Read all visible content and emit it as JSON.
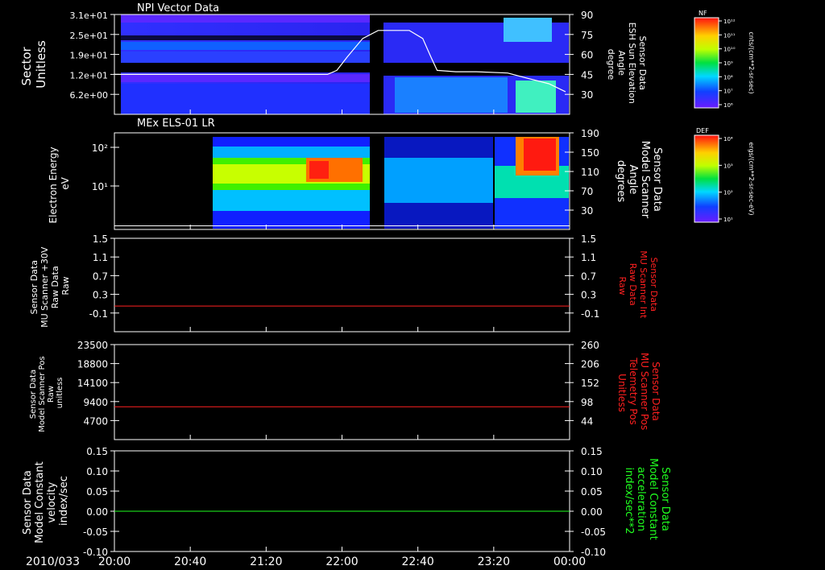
{
  "chart_data": [
    {
      "type": "heatmap",
      "panel": "npi",
      "title": "NPI Vector Data",
      "ylabel": [
        "Sector",
        "Unitless"
      ],
      "yticks": [
        "3.1e+01",
        "2.5e+01",
        "1.9e+01",
        "1.2e+01",
        "6.2e+00"
      ],
      "y2label": [
        "Sensor Data",
        "ESH Sun Elevation",
        "Angle",
        "degree"
      ],
      "y2ticks": [
        "90",
        "75",
        "60",
        "45",
        "30"
      ],
      "y2lim": [
        15,
        90
      ],
      "colorbar": {
        "label": "NF",
        "units": "cnts/(cm**2-sr-sec)",
        "ticks": [
          "10¹²",
          "10¹¹",
          "10¹⁰",
          "10⁹",
          "10⁸",
          "10⁷",
          "10⁶"
        ]
      },
      "line_series": {
        "color": "#ffffff",
        "x_minutes": [
          0,
          206,
          215,
          225,
          240,
          255,
          268,
          285,
          298,
          306,
          312,
          330,
          350,
          380,
          400,
          420,
          436
        ],
        "y": [
          45,
          45,
          48,
          58,
          72,
          78,
          78,
          78,
          72,
          58,
          48,
          47,
          47,
          46,
          42,
          38,
          32
        ]
      }
    },
    {
      "type": "heatmap",
      "panel": "els",
      "title": "MEx ELS-01 LR",
      "ylabel": [
        "Electron Energy",
        "eV"
      ],
      "yticks": [
        "10²",
        "10¹"
      ],
      "y2label": [
        "Sensor Data",
        "Model Scanner",
        "Angle",
        "degrees"
      ],
      "y2ticks": [
        "190",
        "150",
        "110",
        "70",
        "30"
      ],
      "y2lim": [
        5,
        190
      ],
      "colorbar": {
        "label": "DEF",
        "units": "ergs/(cm**2-sr-sec-eV)",
        "ticks": [
          "10⁴",
          "10³",
          "10²",
          "10¹"
        ]
      },
      "line_series": {
        "color": "#ffffff",
        "x_minutes": [
          0,
          440
        ],
        "y": [
          12,
          12
        ]
      }
    },
    {
      "type": "line",
      "panel": "mu-int",
      "ylabel": [
        "Sensor Data",
        "MU Scanner +30V",
        "Raw Data",
        "Raw"
      ],
      "yticks": [
        "1.5",
        "1.1",
        "0.7",
        "0.3",
        "-0.1"
      ],
      "ylim": [
        -0.5,
        1.5
      ],
      "y2label": [
        "Sensor Data",
        "MU Scanner Int",
        "Raw Data",
        "Raw"
      ],
      "y2ticks": [
        "1.5",
        "1.1",
        "0.7",
        "0.3",
        "-0.1"
      ],
      "series": [
        {
          "color": "#ff2020",
          "x_minutes": [
            0,
            440
          ],
          "y": [
            0.05,
            0.05
          ]
        }
      ]
    },
    {
      "type": "line",
      "panel": "scanner-pos",
      "ylabel": [
        "Sensor Data",
        "Model Scanner Pos",
        "Raw",
        "unitless"
      ],
      "yticks": [
        "23500",
        "18800",
        "14100",
        "9400",
        "4700"
      ],
      "ylim": [
        0,
        23500
      ],
      "y2label": [
        "Sensor Data",
        "MU Scanner Pos",
        "Telemetry Pos",
        "Unitless"
      ],
      "y2ticks": [
        "260",
        "206",
        "152",
        "98",
        "44"
      ],
      "series": [
        {
          "color": "#ff2020",
          "x_minutes": [
            0,
            440
          ],
          "y": [
            8100,
            8100
          ]
        }
      ]
    },
    {
      "type": "line",
      "panel": "velocity",
      "ylabel": [
        "Sensor Data",
        "Model Constant",
        "velocity",
        "index/sec"
      ],
      "yticks": [
        "0.15",
        "0.10",
        "0.05",
        "0.00",
        "-0.05",
        "-0.10"
      ],
      "ylim": [
        -0.1,
        0.15
      ],
      "y2label": [
        "Sensor Data",
        "Model Constant",
        "acceleration",
        "index/sec**2"
      ],
      "y2ticks": [
        "0.15",
        "0.10",
        "0.05",
        "0.00",
        "-0.05",
        "-0.10"
      ],
      "series": [
        {
          "color": "#20ff20",
          "x_minutes": [
            0,
            440
          ],
          "y": [
            0.0,
            0.0
          ]
        }
      ]
    }
  ],
  "time_axis": {
    "date": "2010/033",
    "ticks": [
      "20:00",
      "20:40",
      "21:20",
      "22:00",
      "22:40",
      "23:20",
      "00:00"
    ],
    "span_minutes": 240
  },
  "colors": {
    "background": "#000000",
    "axis": "#ffffff",
    "y2_red": "#ff2020",
    "y2_green": "#20ff20"
  }
}
